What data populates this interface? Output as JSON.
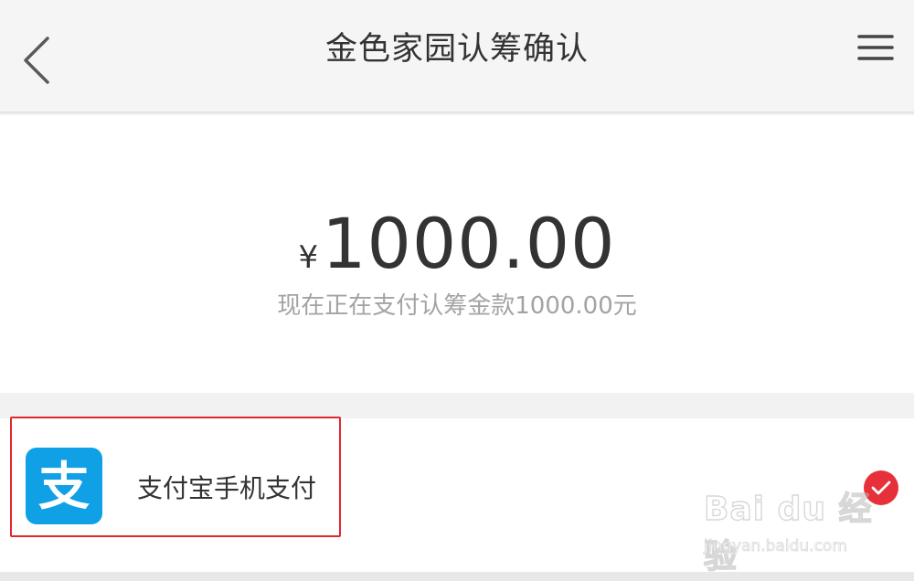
{
  "header": {
    "title": "金色家园认筹确认",
    "back_icon": "chevron-left-icon",
    "menu_icon": "hamburger-menu-icon"
  },
  "payment": {
    "currency_symbol": "¥",
    "amount": "1000.00",
    "description": "现在正在支付认筹金款1000.00元"
  },
  "methods": [
    {
      "label": "支付宝手机支付",
      "icon": "alipay-logo-icon",
      "icon_glyph": "支",
      "selected": true
    }
  ],
  "watermark": {
    "brand": "Bai du 经验",
    "url": "jingyan.baidu.com"
  },
  "colors": {
    "alipay_blue": "#10a0e6",
    "check_red": "#e8303a",
    "highlight_red": "#e0282e"
  }
}
